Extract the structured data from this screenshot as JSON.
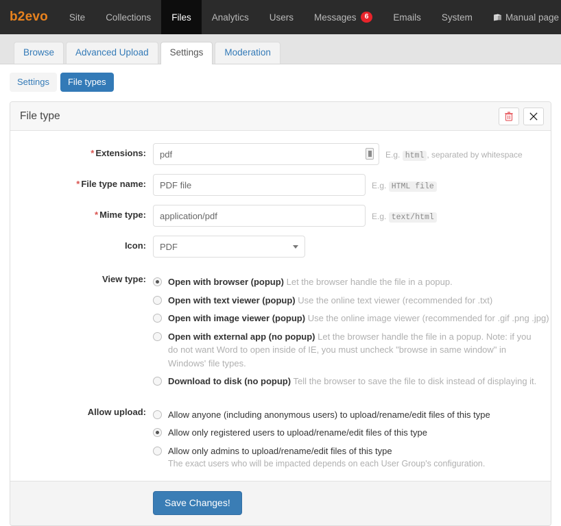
{
  "topnav": {
    "brand": "b2evo",
    "items": [
      {
        "label": "Site",
        "active": false
      },
      {
        "label": "Collections",
        "active": false
      },
      {
        "label": "Files",
        "active": true
      },
      {
        "label": "Analytics",
        "active": false
      },
      {
        "label": "Users",
        "active": false
      },
      {
        "label": "Messages",
        "active": false,
        "badge": "6"
      },
      {
        "label": "Emails",
        "active": false
      },
      {
        "label": "System",
        "active": false
      }
    ],
    "manual_label": "Manual page"
  },
  "subtabs": [
    {
      "label": "Browse",
      "active": false
    },
    {
      "label": "Advanced Upload",
      "active": false
    },
    {
      "label": "Settings",
      "active": true
    },
    {
      "label": "Moderation",
      "active": false
    }
  ],
  "pills": [
    {
      "label": "Settings",
      "active": false
    },
    {
      "label": "File types",
      "active": true
    }
  ],
  "panel": {
    "title": "File type",
    "delete_title": "Delete",
    "close_title": "Close"
  },
  "form": {
    "extensions": {
      "label": "Extensions:",
      "required": true,
      "value": "pdf",
      "help_prefix": "E.g.",
      "help_code": "html",
      "help_suffix": ", separated by whitespace"
    },
    "file_type_name": {
      "label": "File type name:",
      "required": true,
      "value": "PDF file",
      "help_prefix": "E.g.",
      "help_code": "HTML file",
      "help_suffix": ""
    },
    "mime_type": {
      "label": "Mime type:",
      "required": true,
      "value": "application/pdf",
      "help_prefix": "E.g.",
      "help_code": "text/html",
      "help_suffix": ""
    },
    "icon": {
      "label": "Icon:",
      "selected": "PDF",
      "options": [
        "PDF"
      ]
    },
    "view_type": {
      "label": "View type:",
      "options": [
        {
          "title": "Open with browser (popup)",
          "desc": "Let the browser handle the file in a popup.",
          "checked": true
        },
        {
          "title": "Open with text viewer (popup)",
          "desc": "Use the online text viewer (recommended for .txt)",
          "checked": false
        },
        {
          "title": "Open with image viewer (popup)",
          "desc": "Use the online image viewer (recommended for .gif .png .jpg)",
          "checked": false
        },
        {
          "title": "Open with external app (no popup)",
          "desc": "Let the browser handle the file in a popup. Note: if you do not want Word to open inside of IE, you must uncheck \"browse in same window\" in Windows' file types.",
          "checked": false
        },
        {
          "title": "Download to disk (no popup)",
          "desc": "Tell the browser to save the file to disk instead of displaying it.",
          "checked": false
        }
      ]
    },
    "allow_upload": {
      "label": "Allow upload:",
      "options": [
        {
          "title": "Allow anyone (including anonymous users) to upload/rename/edit files of this type",
          "checked": false
        },
        {
          "title": "Allow only registered users to upload/rename/edit files of this type",
          "checked": true
        },
        {
          "title": "Allow only admins to upload/rename/edit files of this type",
          "checked": false
        }
      ],
      "note": "The exact users who will be impacted depends on each User Group's configuration."
    }
  },
  "footer": {
    "save_label": "Save Changes!"
  },
  "colors": {
    "brand_orange": "#e8821e",
    "nav_bg": "#2b2b2b",
    "nav_active_bg": "#0d0d0d",
    "link_blue": "#337ab7",
    "primary_btn": "#3a7db5",
    "badge_red": "#e8242b",
    "required_red": "#d9534f"
  }
}
